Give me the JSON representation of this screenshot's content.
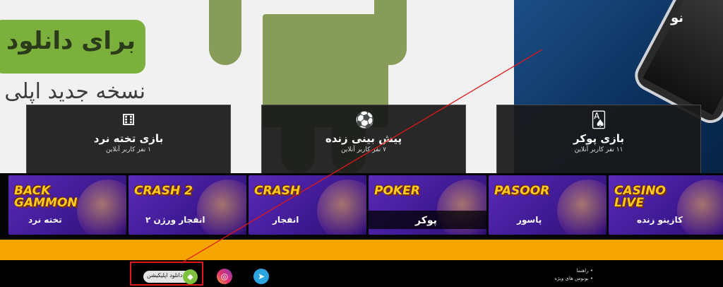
{
  "hero": {
    "download_text": "برای دانلود",
    "subtitle": "نسخه جدید اپلی",
    "phone_text": "نو"
  },
  "cards": [
    {
      "icon": "dice-icon",
      "title": "بازی تخته نرد",
      "subtitle": "۱ نفر کاربر آنلاین"
    },
    {
      "icon": "soccer-ball-icon",
      "title": "پیش بینی زنده",
      "subtitle": "۷ نفر کاربر آنلاین"
    },
    {
      "icon": "playing-cards-icon",
      "title": "بازی پوکر",
      "subtitle": "۱۱ نفر کاربر آنلاین"
    }
  ],
  "games": [
    {
      "logo": "BACK GAMMON",
      "fa": "تخته نرد"
    },
    {
      "logo": "CRASH 2",
      "fa": "انفجار ورژن ۲"
    },
    {
      "logo": "CRASH",
      "fa": "انفجار"
    },
    {
      "logo": "POKER",
      "fa": "پوکر"
    },
    {
      "logo": "PASOOR",
      "fa": "پاسور"
    },
    {
      "logo": "CASINO LIVE",
      "fa": "کازینو زنده"
    }
  ],
  "footer": {
    "download_app_label": "دانلود اپلیکیشن",
    "links": [
      "راهنما",
      "بونوس های ویژه"
    ]
  },
  "colors": {
    "accent_orange": "#f7a500",
    "tile_purple": "#4b1fa3",
    "annotation_red": "#e01818"
  }
}
